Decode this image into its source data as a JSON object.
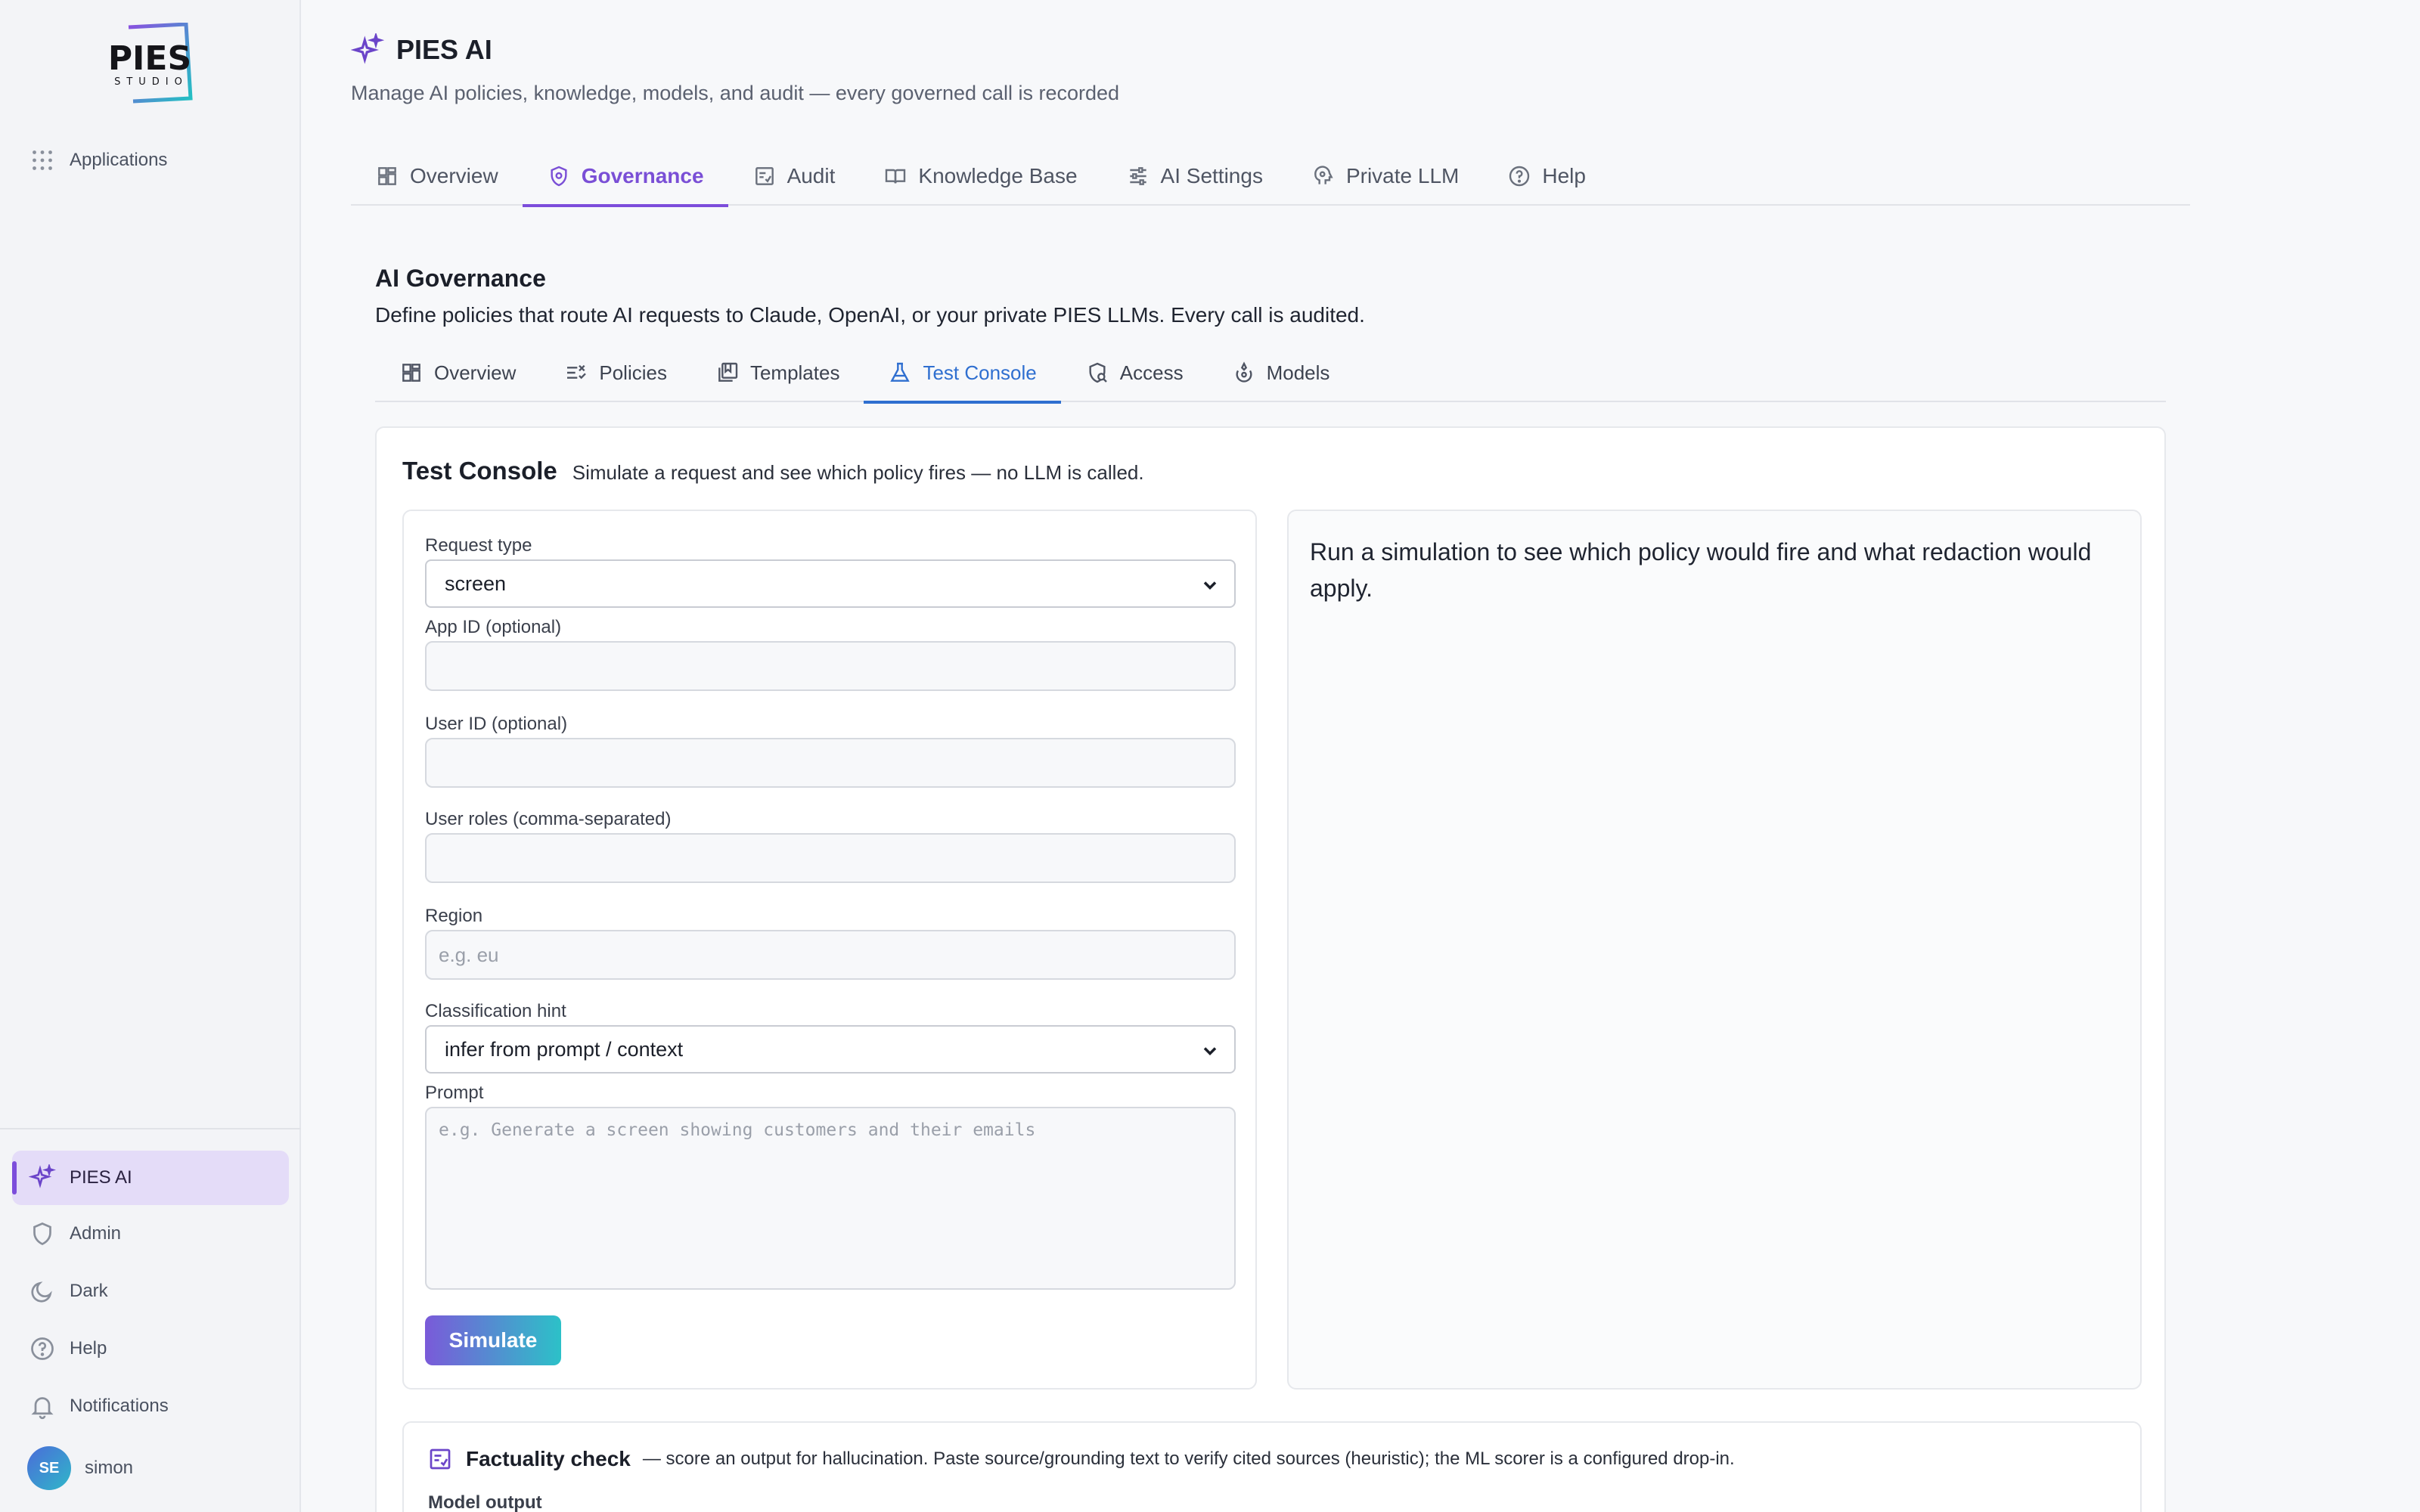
{
  "sidebar": {
    "logo_text": "PIES",
    "logo_sub": "STUDIO",
    "top_items": [
      {
        "label": "Applications",
        "icon": "grid-dots-icon"
      }
    ],
    "bottom_items": [
      {
        "label": "PIES AI",
        "icon": "sparkle-icon",
        "active": true
      },
      {
        "label": "Admin",
        "icon": "shield-icon"
      },
      {
        "label": "Dark",
        "icon": "moon-icon"
      },
      {
        "label": "Help",
        "icon": "help-circle-icon"
      },
      {
        "label": "Notifications",
        "icon": "bell-icon"
      }
    ],
    "user": {
      "initials": "SE",
      "name": "simon"
    }
  },
  "header": {
    "title": "PIES AI",
    "subtitle": "Manage AI policies, knowledge, models, and audit — every governed call is recorded"
  },
  "main_tabs": [
    {
      "label": "Overview",
      "icon": "dashboard-icon"
    },
    {
      "label": "Governance",
      "icon": "shield-check-icon",
      "active": true
    },
    {
      "label": "Audit",
      "icon": "checklist-icon"
    },
    {
      "label": "Knowledge Base",
      "icon": "book-icon"
    },
    {
      "label": "AI Settings",
      "icon": "sliders-icon"
    },
    {
      "label": "Private LLM",
      "icon": "brain-icon"
    },
    {
      "label": "Help",
      "icon": "help-circle-icon"
    }
  ],
  "governance": {
    "title": "AI Governance",
    "description": "Define policies that route AI requests to Claude, OpenAI, or your private PIES LLMs. Every call is audited."
  },
  "sub_tabs": [
    {
      "label": "Overview",
      "icon": "dashboard-icon"
    },
    {
      "label": "Policies",
      "icon": "list-check-icon"
    },
    {
      "label": "Templates",
      "icon": "template-icon"
    },
    {
      "label": "Test Console",
      "icon": "flask-icon",
      "active": true
    },
    {
      "label": "Access",
      "icon": "user-shield-icon"
    },
    {
      "label": "Models",
      "icon": "model-icon"
    }
  ],
  "console": {
    "title": "Test Console",
    "description": "Simulate a request and see which policy fires — no LLM is called.",
    "form": {
      "request_type": {
        "label": "Request type",
        "value": "screen"
      },
      "app_id": {
        "label": "App ID (optional)",
        "value": "",
        "placeholder": ""
      },
      "user_id": {
        "label": "User ID (optional)",
        "value": "",
        "placeholder": ""
      },
      "user_roles": {
        "label": "User roles (comma-separated)",
        "value": "",
        "placeholder": ""
      },
      "region": {
        "label": "Region",
        "value": "",
        "placeholder": "e.g. eu"
      },
      "classification": {
        "label": "Classification hint",
        "value": "infer from prompt / context"
      },
      "prompt": {
        "label": "Prompt",
        "value": "",
        "placeholder": "e.g. Generate a screen showing customers and their emails"
      },
      "simulate_label": "Simulate"
    },
    "result_placeholder": "Run a simulation to see which policy would fire and what redaction would apply."
  },
  "factuality": {
    "title": "Factuality check",
    "description": "— score an output for hallucination. Paste source/grounding text to verify cited sources (heuristic); the ML scorer is a configured drop-in.",
    "model_output_label": "Model output"
  },
  "colors": {
    "accent": "#7c4ddb",
    "link": "#2f6fd0",
    "button_gradient_start": "#7a5ad9",
    "button_gradient_end": "#2cc1c8"
  }
}
